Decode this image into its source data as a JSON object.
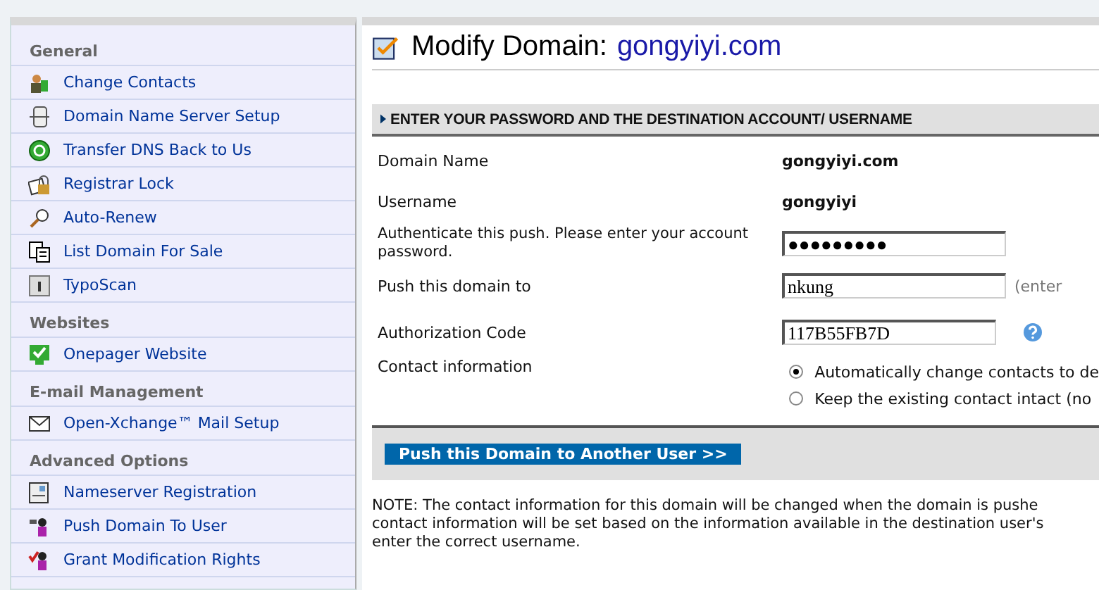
{
  "sidebar": {
    "sections": [
      {
        "heading": "General",
        "items": [
          {
            "label": "Change Contacts"
          },
          {
            "label": "Domain Name Server Setup"
          },
          {
            "label": "Transfer DNS Back to Us"
          },
          {
            "label": "Registrar Lock"
          },
          {
            "label": "Auto-Renew"
          },
          {
            "label": "List Domain For Sale"
          },
          {
            "label": "TypoScan"
          }
        ]
      },
      {
        "heading": "Websites",
        "items": [
          {
            "label": "Onepager Website"
          }
        ]
      },
      {
        "heading": "E-mail Management",
        "items": [
          {
            "label": "Open-Xchange™ Mail Setup"
          }
        ]
      },
      {
        "heading": "Advanced Options",
        "items": [
          {
            "label": "Nameserver Registration"
          },
          {
            "label": "Push Domain To User"
          },
          {
            "label": "Grant Modification Rights"
          }
        ]
      }
    ]
  },
  "page": {
    "title": "Modify Domain:",
    "domain": "gongyiyi.com",
    "section_header": "ENTER YOUR PASSWORD AND THE DESTINATION ACCOUNT/ USERNAME",
    "rows": [
      {
        "kind": "static",
        "label": "Domain Name",
        "value": "gongyiyi.com"
      },
      {
        "kind": "static",
        "label": "Username",
        "value": "gongyiyi"
      },
      {
        "kind": "password",
        "label": "Authenticate this push. Please enter your account password.",
        "value": "●●●●●●●●●"
      },
      {
        "kind": "text",
        "label": "Push this domain to",
        "value": "nkung",
        "hint": "(enter"
      },
      {
        "kind": "code",
        "label": "Authorization Code",
        "value": "117B55FB7D"
      },
      {
        "kind": "radios",
        "label": "Contact information",
        "options": [
          {
            "label": "Automatically change contacts to de",
            "selected": true
          },
          {
            "label": "Keep the existing contact intact (no",
            "selected": false
          }
        ]
      }
    ],
    "submit_button": "Push this Domain to Another User >>",
    "note": [
      "NOTE: The contact information for this domain will be changed when the domain is pushe",
      "contact information will be set based on the information available in the destination user's",
      "enter the correct username."
    ]
  }
}
